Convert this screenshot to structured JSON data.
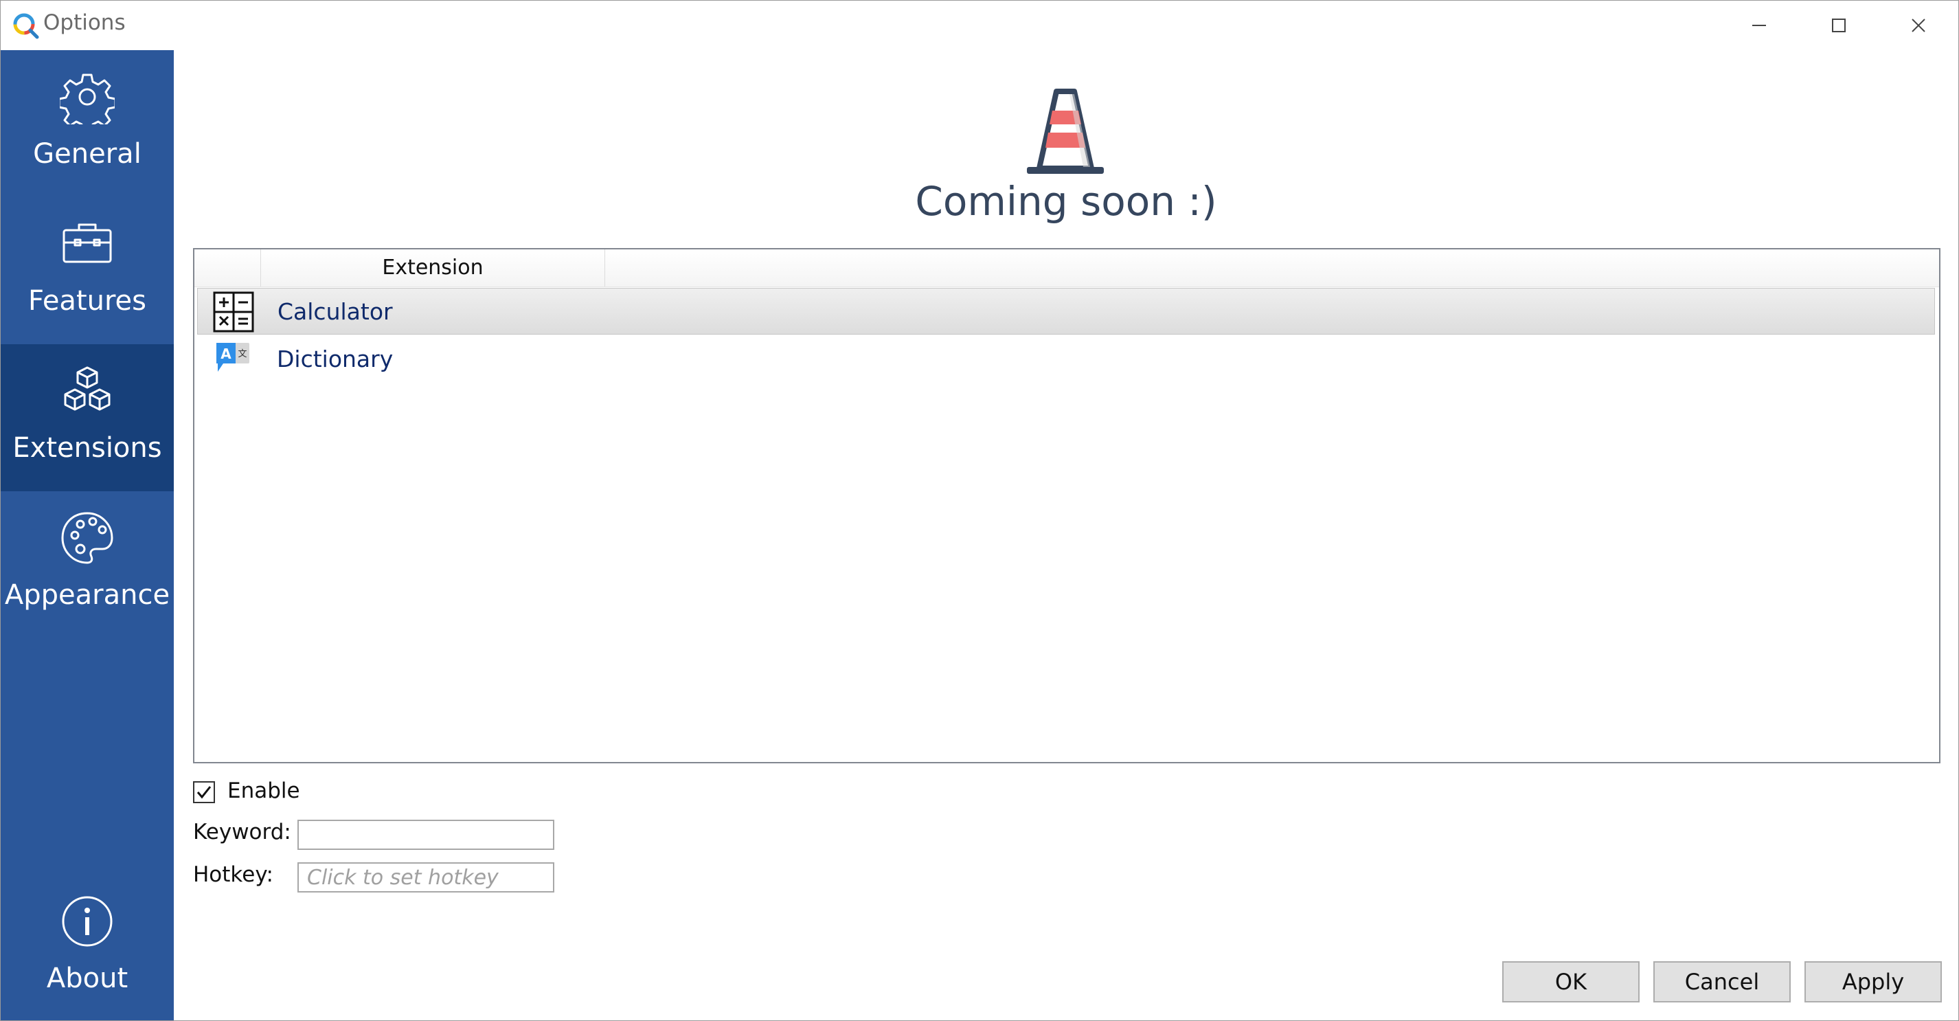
{
  "window": {
    "title": "Options"
  },
  "sidebar": {
    "items": [
      {
        "label": "General",
        "icon": "gear-icon"
      },
      {
        "label": "Features",
        "icon": "toolbox-icon"
      },
      {
        "label": "Extensions",
        "icon": "cubes-icon",
        "active": true
      },
      {
        "label": "Appearance",
        "icon": "palette-icon"
      },
      {
        "label": "About",
        "icon": "info-icon"
      }
    ]
  },
  "main": {
    "banner": {
      "icon": "traffic-cone-icon",
      "text": "Coming soon :)"
    },
    "list": {
      "column_header": "Extension",
      "rows": [
        {
          "label": "Calculator",
          "icon": "calculator-icon",
          "selected": true
        },
        {
          "label": "Dictionary",
          "icon": "translate-icon",
          "selected": false
        }
      ]
    },
    "enable": {
      "label": "Enable",
      "checked": true
    },
    "keyword": {
      "label": "Keyword:",
      "value": ""
    },
    "hotkey": {
      "label": "Hotkey:",
      "placeholder": "Click to set hotkey"
    }
  },
  "buttons": {
    "ok": "OK",
    "cancel": "Cancel",
    "apply": "Apply"
  },
  "colors": {
    "sidebar": "#2b579a",
    "sidebar_active": "#17407a",
    "cone_stripe": "#ee6b6b"
  }
}
